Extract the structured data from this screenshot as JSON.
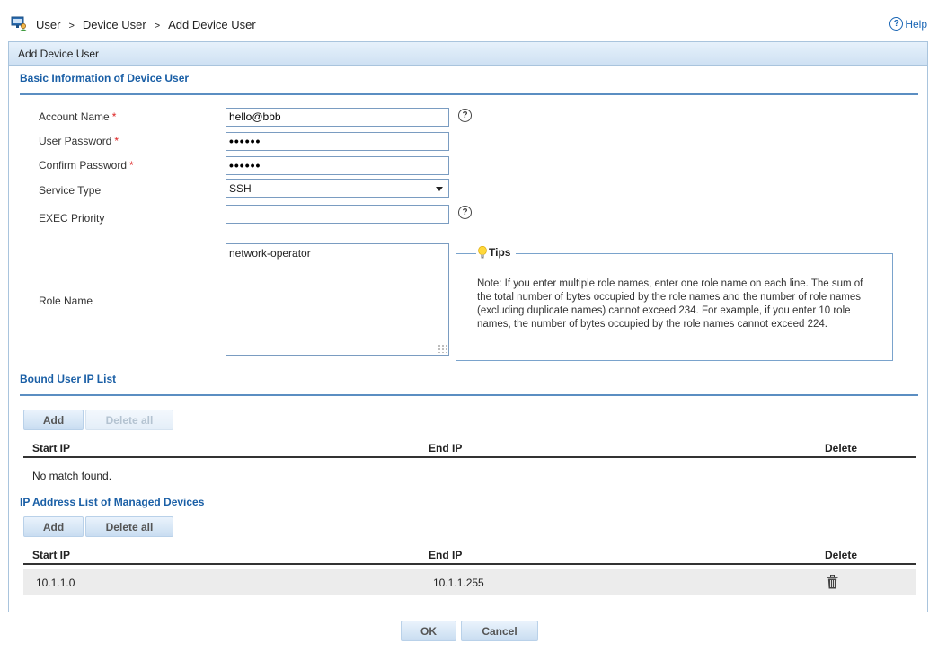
{
  "breadcrumb": [
    "User",
    "Device User",
    "Add Device User"
  ],
  "breadcrumb_sep": ">",
  "help_label": "Help",
  "panel_title": "Add Device User",
  "basic": {
    "title": "Basic Information of Device User",
    "account_label": "Account Name",
    "account_value": "hello@bbb",
    "password_label": "User Password",
    "password_value": "••••••",
    "confirm_label": "Confirm Password",
    "confirm_value": "••••••",
    "service_label": "Service Type",
    "service_value": "SSH",
    "exec_label": "EXEC Priority",
    "exec_value": "",
    "role_label": "Role Name",
    "role_value": "network-operator",
    "required_mark": "*"
  },
  "tips": {
    "title": "Tips",
    "text": "Note: If you enter multiple role names, enter one role name on each line. The sum of the total number of bytes occupied by the role names and the number of role names (excluding duplicate names) cannot exceed 234. For example, if you enter 10 role names, the number of bytes occupied by the role names cannot exceed 224."
  },
  "bound": {
    "title": "Bound User IP List",
    "add_label": "Add",
    "delete_all_label": "Delete all",
    "col_start": "Start IP",
    "col_end": "End IP",
    "col_delete": "Delete",
    "empty_text": "No match found."
  },
  "managed": {
    "title": "IP Address List of Managed Devices",
    "add_label": "Add",
    "delete_all_label": "Delete all",
    "col_start": "Start IP",
    "col_end": "End IP",
    "col_delete": "Delete",
    "rows": [
      {
        "start": "10.1.1.0",
        "end": "10.1.1.255"
      }
    ]
  },
  "footer": {
    "ok_label": "OK",
    "cancel_label": "Cancel"
  },
  "colors": {
    "accent": "#1a5fa6",
    "required": "#dd2222",
    "panel_border": "#a9c4dd"
  }
}
